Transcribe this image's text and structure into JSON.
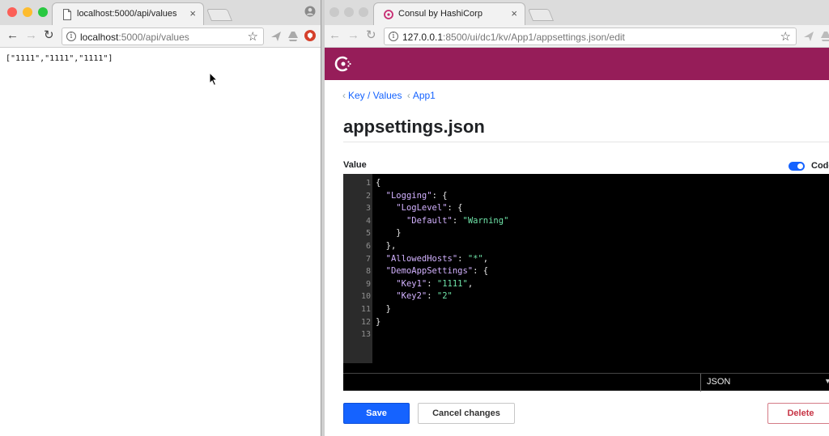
{
  "left_window": {
    "tab": {
      "title": "localhost:5000/api/values",
      "close": "×"
    },
    "url": {
      "host": "localhost",
      "path": ":5000/api/values"
    },
    "content": "[\"1111\",\"1111\",\"1111\"]"
  },
  "right_window": {
    "tab": {
      "title": "Consul by HashiCorp",
      "close": "×"
    },
    "url": {
      "host": "127.0.0.1",
      "path": ":8500/ui/dc1/kv/App1/appsettings.json/edit"
    },
    "breadcrumbs": [
      "Key / Values",
      "App1"
    ],
    "page_title": "appsettings.json",
    "value_label": "Value",
    "toggle_label": "Code",
    "code_lines": [
      [
        {
          "t": "p",
          "v": "{"
        }
      ],
      [
        {
          "t": "p",
          "v": "  "
        },
        {
          "t": "k",
          "v": "\"Logging\""
        },
        {
          "t": "p",
          "v": ": {"
        }
      ],
      [
        {
          "t": "p",
          "v": "    "
        },
        {
          "t": "k",
          "v": "\"LogLevel\""
        },
        {
          "t": "p",
          "v": ": {"
        }
      ],
      [
        {
          "t": "p",
          "v": "      "
        },
        {
          "t": "k",
          "v": "\"Default\""
        },
        {
          "t": "p",
          "v": ": "
        },
        {
          "t": "s",
          "v": "\"Warning\""
        }
      ],
      [
        {
          "t": "p",
          "v": "    }"
        }
      ],
      [
        {
          "t": "p",
          "v": "  },"
        }
      ],
      [
        {
          "t": "p",
          "v": "  "
        },
        {
          "t": "k",
          "v": "\"AllowedHosts\""
        },
        {
          "t": "p",
          "v": ": "
        },
        {
          "t": "s",
          "v": "\"*\""
        },
        {
          "t": "p",
          "v": ","
        }
      ],
      [
        {
          "t": "p",
          "v": "  "
        },
        {
          "t": "k",
          "v": "\"DemoAppSettings\""
        },
        {
          "t": "p",
          "v": ": {"
        }
      ],
      [
        {
          "t": "p",
          "v": "    "
        },
        {
          "t": "k",
          "v": "\"Key1\""
        },
        {
          "t": "p",
          "v": ": "
        },
        {
          "t": "s",
          "v": "\"1111\""
        },
        {
          "t": "p",
          "v": ","
        }
      ],
      [
        {
          "t": "p",
          "v": "    "
        },
        {
          "t": "k",
          "v": "\"Key2\""
        },
        {
          "t": "p",
          "v": ": "
        },
        {
          "t": "s",
          "v": "\"2\""
        }
      ],
      [
        {
          "t": "p",
          "v": "  }"
        }
      ],
      [
        {
          "t": "p",
          "v": "}"
        }
      ],
      []
    ],
    "mode": "JSON",
    "buttons": {
      "save": "Save",
      "cancel": "Cancel changes",
      "delete": "Delete"
    }
  },
  "colors": {
    "consul_header": "#961d59",
    "primary": "#1563ff",
    "danger": "#c73445"
  },
  "icons": [
    "page-icon",
    "consul-logo-icon",
    "back-arrow-icon",
    "forward-arrow-icon",
    "reload-icon",
    "info-icon",
    "star-icon",
    "mouse-cursor-icon"
  ]
}
